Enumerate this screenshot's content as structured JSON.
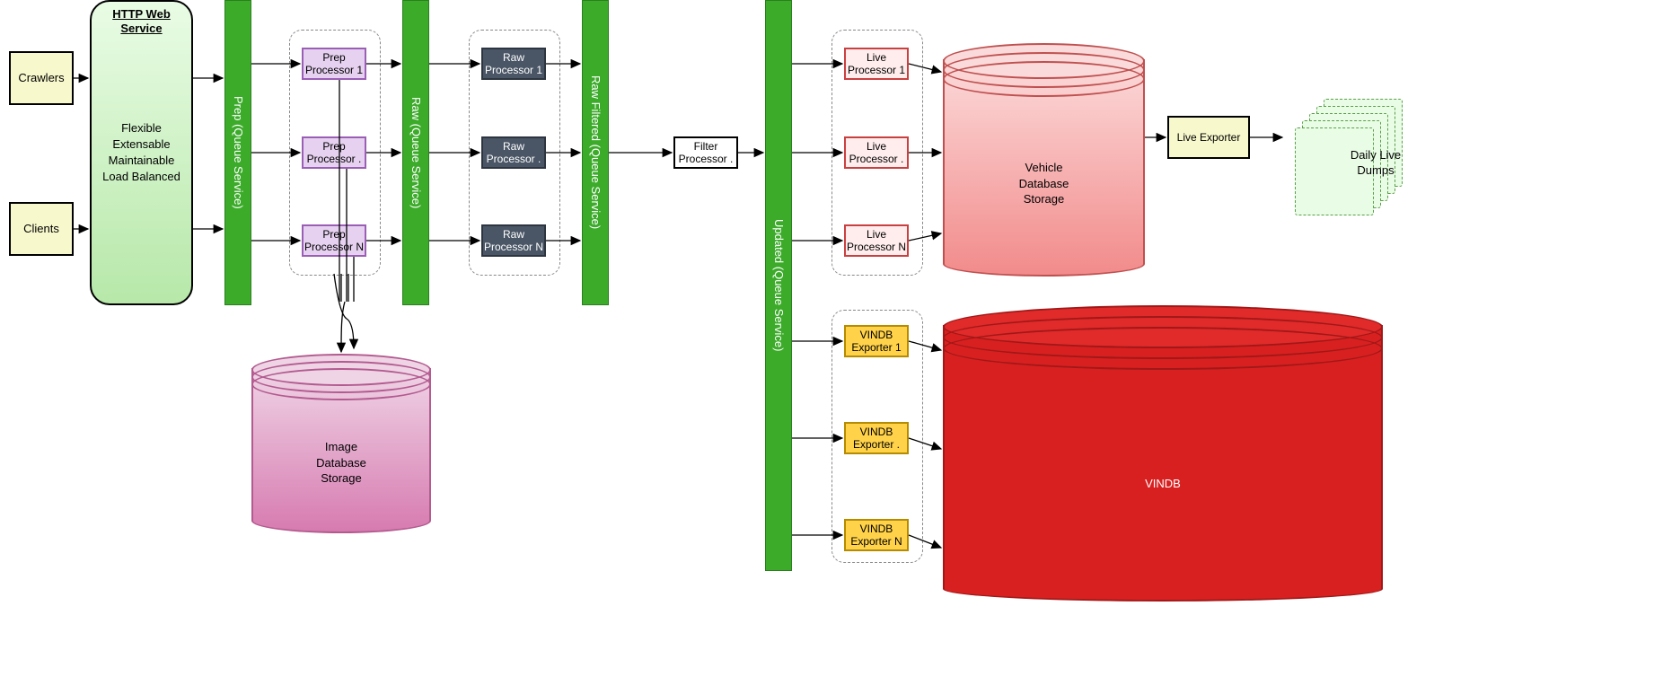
{
  "sources": {
    "crawlers": "Crawlers",
    "clients": "Clients"
  },
  "webservice": {
    "title": "HTTP Web Service",
    "body_lines": [
      "Flexible",
      "Extensable",
      "Maintainable",
      "Load Balanced"
    ]
  },
  "queues": {
    "prep": "Prep (Queue Service)",
    "raw": "Raw (Queue Service)",
    "raw_filtered": "Raw Filtered (Queue Service)",
    "updated": "Updated (Queue Service)"
  },
  "prep_processors": {
    "items": [
      "Prep\nProcessor 1",
      "Prep\nProcessor .",
      "Prep\nProcessor N"
    ]
  },
  "raw_processors": {
    "items": [
      "Raw\nProcessor 1",
      "Raw\nProcessor .",
      "Raw\nProcessor N"
    ]
  },
  "filter_processor": "Filter\nProcessor .",
  "live_processors": {
    "items": [
      "Live\nProcessor 1",
      "Live\nProcessor .",
      "Live\nProcessor N"
    ]
  },
  "vindb_exporters": {
    "items": [
      "VINDB\nExporter 1",
      "VINDB\nExporter .",
      "VINDB\nExporter N"
    ]
  },
  "storages": {
    "image_db": "Image\nDatabase\nStorage",
    "vehicle_db": "Vehicle\nDatabase\nStorage",
    "vindb": "VINDB"
  },
  "live_exporter": "Live Exporter",
  "daily_dumps": "Daily Live\nDumps",
  "colors": {
    "yellow_bg": "#f8f8cd",
    "green_queue": "#3cab2a",
    "prep_border": "#9a5fb5",
    "raw_bg": "#4a5666",
    "live_border": "#c94040",
    "vindb_bg": "#ffd24a",
    "pink_cyl": "#d77bb0",
    "red_cyl_light": "#f28b8b",
    "red_cyl_dark": "#d92020"
  }
}
